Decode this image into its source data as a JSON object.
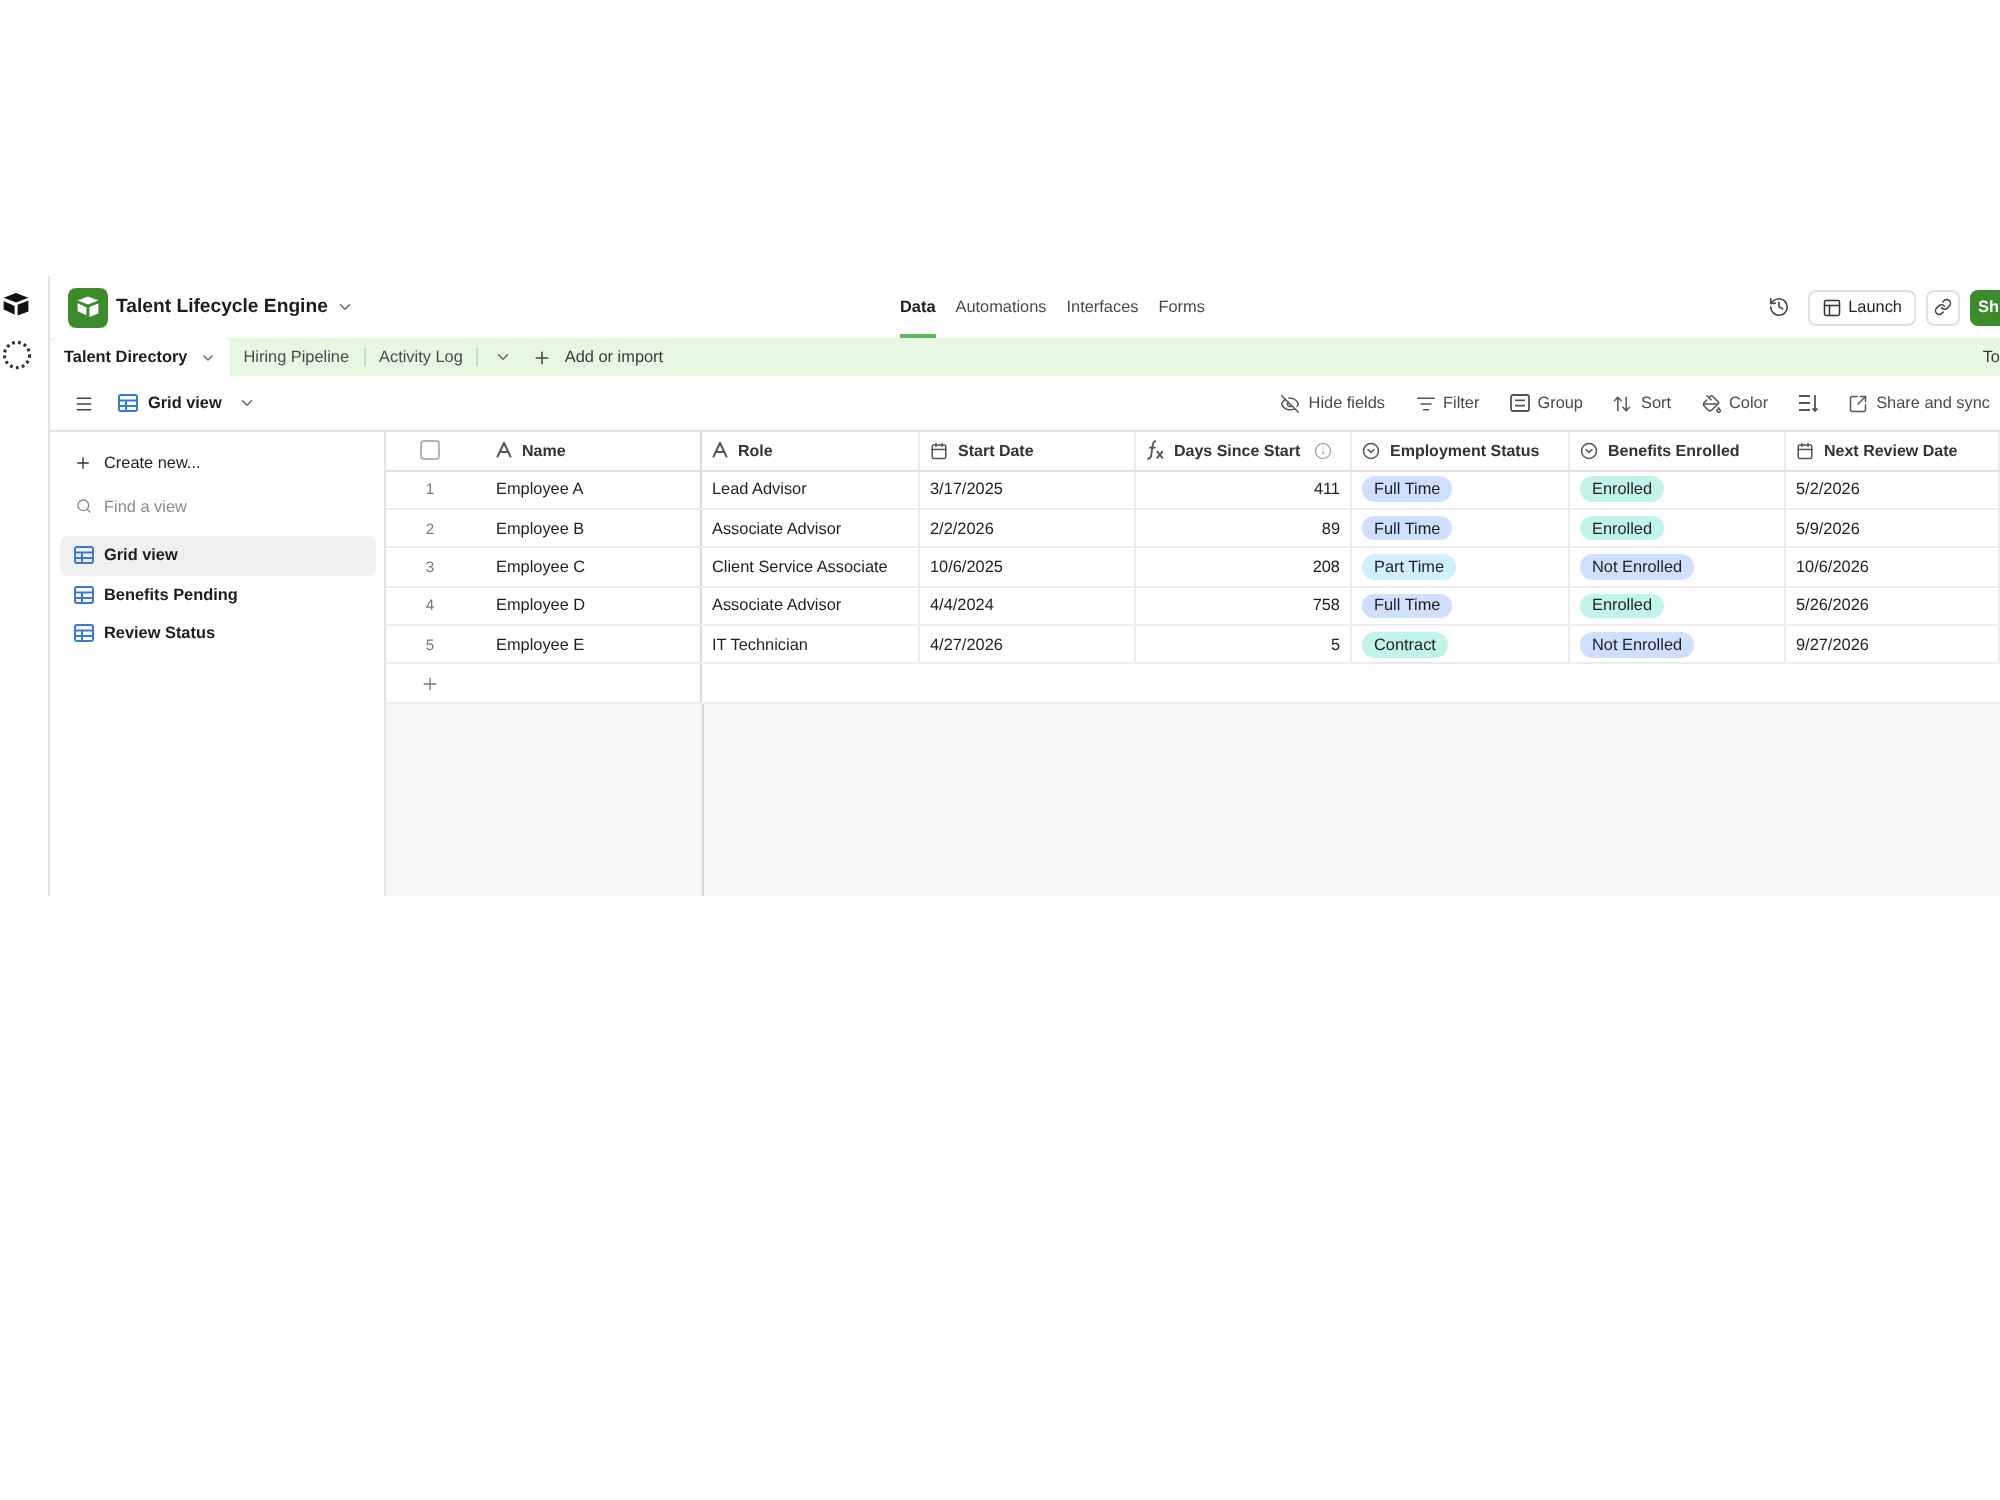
{
  "base": {
    "title": "Talent Lifecycle Engine"
  },
  "nav_tabs": [
    {
      "label": "Data",
      "selected": true
    },
    {
      "label": "Automations",
      "selected": false
    },
    {
      "label": "Interfaces",
      "selected": false
    },
    {
      "label": "Forms",
      "selected": false
    }
  ],
  "header_actions": {
    "launch": "Launch",
    "share": "Sh"
  },
  "table_tabs": [
    {
      "label": "Talent Directory",
      "selected": true
    },
    {
      "label": "Hiring Pipeline",
      "selected": false
    },
    {
      "label": "Activity Log",
      "selected": false
    }
  ],
  "add_table": "Add or import",
  "tab_bar_button": {
    "label": "To"
  },
  "view": {
    "name": "Grid view"
  },
  "toolbar": [
    {
      "kind": "hide_fields",
      "label": "Hide fields"
    },
    {
      "kind": "filter",
      "label": "Filter"
    },
    {
      "kind": "group",
      "label": "Group"
    },
    {
      "kind": "sort",
      "label": "Sort"
    },
    {
      "kind": "color",
      "label": "Color"
    },
    {
      "kind": "row_height"
    },
    {
      "kind": "share",
      "label": "Share and sync"
    }
  ],
  "sidebar": {
    "create": "Create new...",
    "search": {
      "placeholder": "Find a view"
    },
    "views": [
      {
        "label": "Grid view",
        "selected": true
      },
      {
        "label": "Benefits Pending",
        "selected": false
      },
      {
        "label": "Review Status",
        "selected": false
      }
    ]
  },
  "table": {
    "select_all": {
      "checked": false
    },
    "columns": [
      {
        "label": "Name",
        "kind": "text"
      },
      {
        "label": "Role",
        "kind": "text"
      },
      {
        "label": "Start Date",
        "kind": "date"
      },
      {
        "label": "Days Since Start",
        "kind": "formula"
      },
      {
        "label": "Employment Status",
        "kind": "select"
      },
      {
        "label": "Benefits Enrolled",
        "kind": "select"
      },
      {
        "label": "Next Review Date",
        "kind": "date"
      }
    ],
    "rows": [
      {
        "number": "1",
        "cells": [
          {
            "text": "Employee A"
          },
          {
            "text": "Lead Advisor"
          },
          {
            "text": "3/17/2025"
          },
          {
            "text": "411"
          },
          {
            "text": "Full Time",
            "color": "#cfdfff"
          },
          {
            "text": "Enrolled",
            "color": "#c2f5e9"
          },
          {
            "text": "5/2/2026"
          }
        ]
      },
      {
        "number": "2",
        "cells": [
          {
            "text": "Employee B"
          },
          {
            "text": "Associate Advisor"
          },
          {
            "text": "2/2/2026"
          },
          {
            "text": "89"
          },
          {
            "text": "Full Time",
            "color": "#cfdfff"
          },
          {
            "text": "Enrolled",
            "color": "#c2f5e9"
          },
          {
            "text": "5/9/2026"
          }
        ]
      },
      {
        "number": "3",
        "cells": [
          {
            "text": "Employee C"
          },
          {
            "text": "Client Service Associate"
          },
          {
            "text": "10/6/2025"
          },
          {
            "text": "208"
          },
          {
            "text": "Part Time",
            "color": "#d0f0fd"
          },
          {
            "text": "Not Enrolled",
            "color": "#cfdfff"
          },
          {
            "text": "10/6/2026"
          }
        ]
      },
      {
        "number": "4",
        "cells": [
          {
            "text": "Employee D"
          },
          {
            "text": "Associate Advisor"
          },
          {
            "text": "4/4/2024"
          },
          {
            "text": "758"
          },
          {
            "text": "Full Time",
            "color": "#cfdfff"
          },
          {
            "text": "Enrolled",
            "color": "#c2f5e9"
          },
          {
            "text": "5/26/2026"
          }
        ]
      },
      {
        "number": "5",
        "cells": [
          {
            "text": "Employee E"
          },
          {
            "text": "IT Technician"
          },
          {
            "text": "4/27/2026"
          },
          {
            "text": "5"
          },
          {
            "text": "Contract",
            "color": "#c2f5e9"
          },
          {
            "text": "Not Enrolled",
            "color": "#cfdfff"
          },
          {
            "text": "9/27/2026"
          }
        ]
      }
    ]
  }
}
